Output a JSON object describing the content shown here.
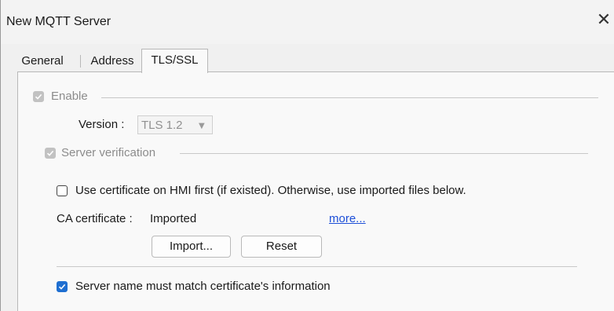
{
  "window": {
    "title": "New MQTT Server",
    "close_symbol": "✕"
  },
  "tabs": [
    {
      "label": "General",
      "active": false
    },
    {
      "label": "Address",
      "active": false
    },
    {
      "label": "TLS/SSL",
      "active": true
    }
  ],
  "tls": {
    "enable": {
      "label": "Enable",
      "checked": true,
      "enabled": false
    },
    "version": {
      "label": "Version :",
      "value": "TLS 1.2"
    },
    "server_verification": {
      "label": "Server verification",
      "checked": true,
      "enabled": false
    },
    "use_cert_hmi": {
      "label": "Use certificate on HMI first (if existed). Otherwise, use imported files below.",
      "checked": false
    },
    "ca_certificate": {
      "label": "CA certificate :",
      "value": "Imported",
      "more_link": "more..."
    },
    "buttons": {
      "import": "Import...",
      "reset": "Reset"
    },
    "server_name_match": {
      "label": "Server name must match certificate's information",
      "checked": true
    }
  },
  "colors": {
    "accent": "#1f6fd1",
    "link": "#1d4fd8",
    "disabled": "#8c8c8c"
  }
}
